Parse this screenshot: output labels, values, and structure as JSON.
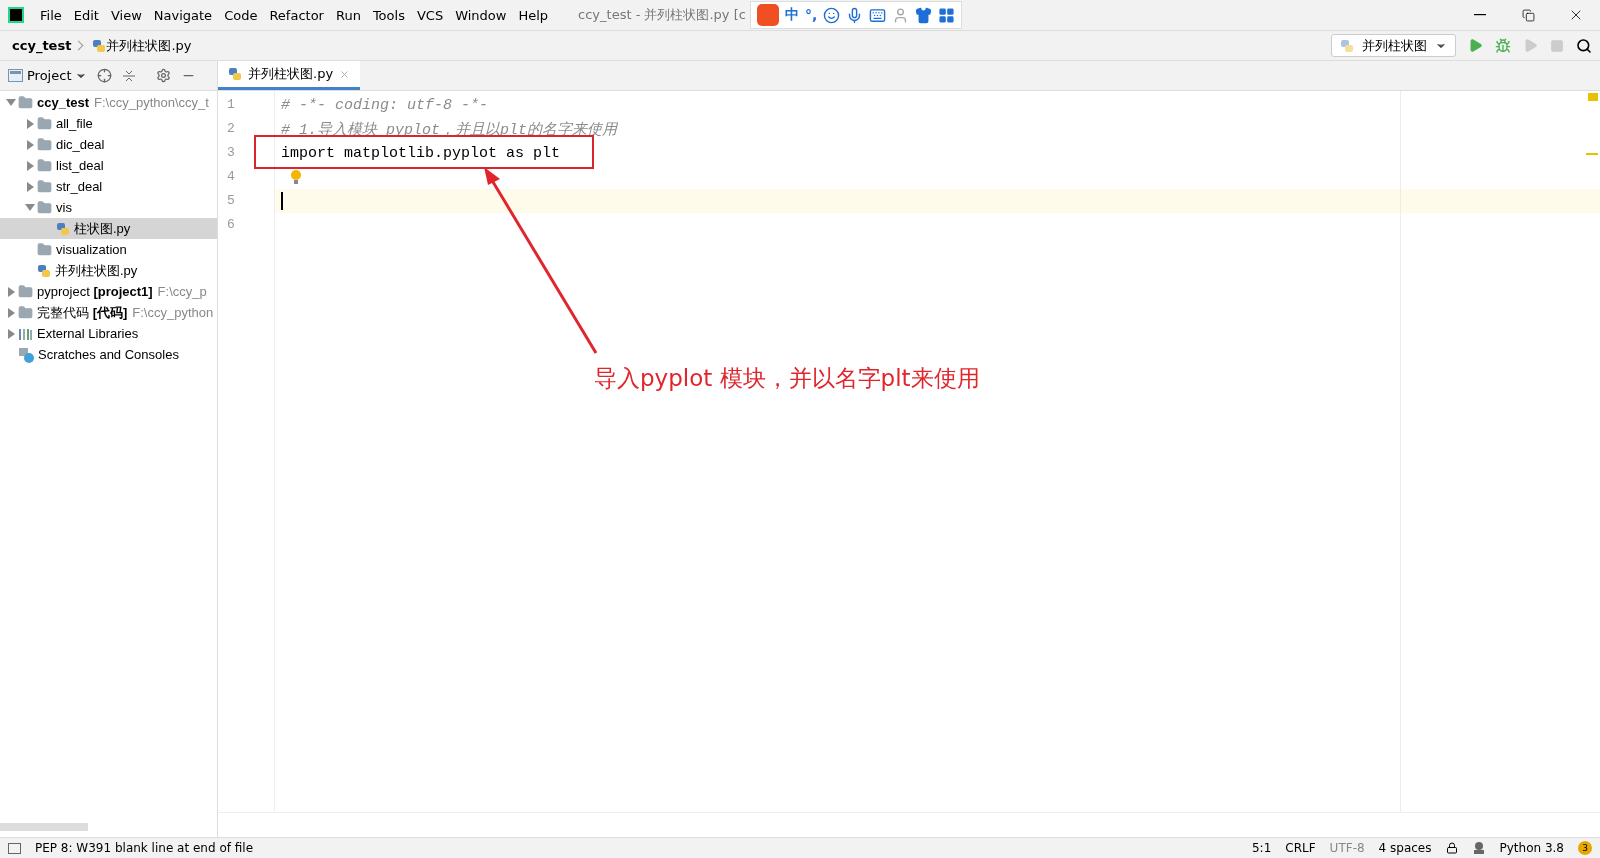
{
  "menu": [
    "File",
    "Edit",
    "View",
    "Navigate",
    "Code",
    "Refactor",
    "Run",
    "Tools",
    "VCS",
    "Window",
    "Help"
  ],
  "window_title": "ccy_test - 并列柱状图.py [c",
  "ime": {
    "mode": "中",
    "punct": "°,"
  },
  "breadcrumb": [
    "ccy_test",
    "并列柱状图.py"
  ],
  "run_config": "并列柱状图",
  "tool_window": "Project",
  "tabs": [
    {
      "label": "并列柱状图.py",
      "selected": true
    }
  ],
  "tree": [
    {
      "name": "ccy_test",
      "path": "F:\\ccy_python\\ccy_t",
      "kind": "folder",
      "bold": true,
      "expanded": true,
      "selected": false,
      "children": [
        {
          "name": "all_file",
          "kind": "folder",
          "expanded": false,
          "selected": false
        },
        {
          "name": "dic_deal",
          "kind": "folder",
          "expanded": false,
          "selected": false
        },
        {
          "name": "list_deal",
          "kind": "folder",
          "expanded": false,
          "selected": false
        },
        {
          "name": "str_deal",
          "kind": "folder",
          "expanded": false,
          "selected": false
        },
        {
          "name": "vis",
          "kind": "folder",
          "expanded": true,
          "selected": false,
          "children": [
            {
              "name": "柱状图.py",
              "kind": "python",
              "selected": true
            }
          ]
        },
        {
          "name": "visualization",
          "kind": "folder",
          "selected": false
        },
        {
          "name": "并列柱状图.py",
          "kind": "python",
          "selected": false
        }
      ]
    },
    {
      "name": "pyproject **[project1]**",
      "path": "F:\\ccy_p",
      "kind": "folder",
      "expanded": false,
      "selected": false
    },
    {
      "name": "完整代码 **[代码]**",
      "path": "F:\\ccy_python",
      "kind": "folder",
      "expanded": false,
      "selected": false
    },
    {
      "name": "External Libraries",
      "kind": "library",
      "expanded": false,
      "selected": false
    },
    {
      "name": "Scratches and Consoles",
      "kind": "scratch",
      "selected": false
    }
  ],
  "lines": [
    {
      "number": "1",
      "text": "# -*- coding: utf-8 -*-",
      "kind": "comment",
      "current": false
    },
    {
      "number": "2",
      "text": "# 1.导入模块 pyplot，并且以plt的名字来使用",
      "kind": "comment",
      "current": false
    },
    {
      "number": "3",
      "text": "import matplotlib.pyplot as plt",
      "kind": "code",
      "current": false
    },
    {
      "number": "4",
      "kind": "bulb",
      "current": false
    },
    {
      "number": "5",
      "kind": "code",
      "current": true
    },
    {
      "number": "6",
      "kind": "code",
      "current": false
    }
  ],
  "annotation": "导入pyplot 模块，并以名字plt来使用",
  "status_bar": {
    "message": "PEP 8: W391 blank line at end of file",
    "position": "5:1",
    "line_separator": "CRLF",
    "encoding": "UTF-8",
    "indent": "4 spaces",
    "interpreter": "Python 3.8",
    "notifications": "3"
  }
}
